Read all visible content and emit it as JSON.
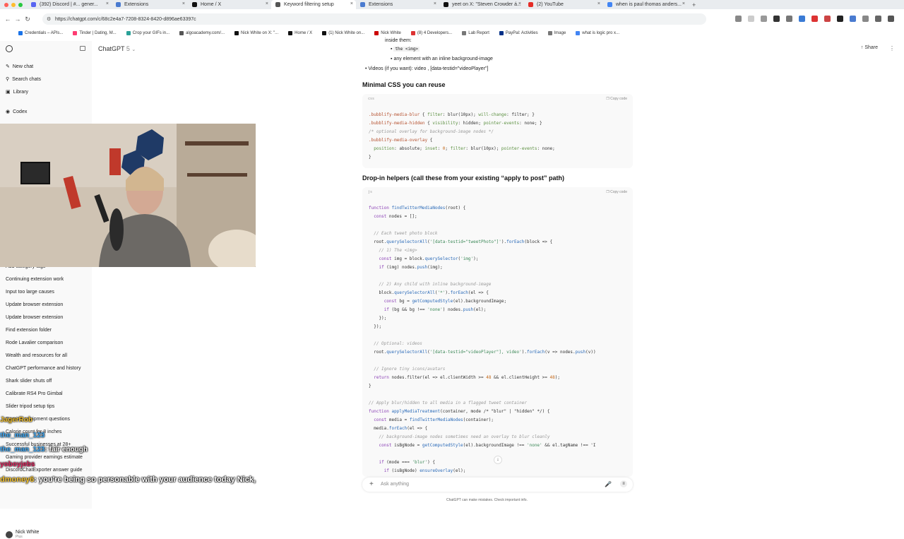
{
  "browser": {
    "tabs": [
      {
        "label": "(392) Discord | #... gener...",
        "color": "#5865f2"
      },
      {
        "label": "Extensions",
        "color": "#4a7bd0"
      },
      {
        "label": "Home / X",
        "color": "#111111"
      },
      {
        "label": "Keyword filtering setup",
        "color": "#555555",
        "active": true
      },
      {
        "label": "Extensions",
        "color": "#4a7bd0"
      },
      {
        "label": "yeet on X: \"Steven Crowder á...",
        "color": "#111111"
      },
      {
        "label": "(2) YouTube",
        "color": "#e52d27"
      },
      {
        "label": "when is paul thomas anders...",
        "color": "#4285f4"
      }
    ],
    "url": "https://chatgpt.com/c/68c2e4a7-7208-8324-8420-d896ae63397c",
    "bookmarks": [
      "Credentials – APIs...",
      "Tinder | Dating, M...",
      "Crop your GIFs in...",
      "algoacademy.com/...",
      "Nick White on X: \"...",
      "Home / X",
      "(1) Nick White on...",
      "Nick White",
      "(8) 4 Developers...",
      "Lab Report",
      "PayPal: Activities",
      "Image",
      "what is logic pro x..."
    ]
  },
  "sidebar": {
    "top_items": [
      "New chat",
      "Search chats",
      "Library",
      "Codex"
    ],
    "chats": [
      "Add category tags",
      "Continuing extension work",
      "Input too large causes",
      "Update browser extension",
      "Update browser extension",
      "Find extension folder",
      "Rode Lavalier comparison",
      "Wealth and resources for all",
      "ChatGPT performance and history",
      "Shark slider shuts off",
      "Calibrate RS4 Pro Gimbal",
      "Slider tripod setup tips",
      "Gaming equipment questions",
      "Calorie count for 8 inches",
      "Successful businesses at 28+",
      "Gaming provider earnings estimate",
      "DiscordChatExporter answer guide"
    ],
    "user_name": "Nick White",
    "user_plan": "Plus"
  },
  "header": {
    "title": "ChatGPT",
    "model": "5",
    "share": "Share"
  },
  "message": {
    "bullets": [
      "inside them:",
      "the <img>",
      "any element with an inline background-image",
      "Videos (if you want): video , [data-testid=\"videoPlayer\"]"
    ],
    "heading1": "Minimal CSS you can reuse",
    "heading2": "Drop-in helpers (call these from your existing “apply to post” path)",
    "css_lang": "css",
    "js_lang": "js",
    "copy_label": "Copy code"
  },
  "css_code": [
    ".bubblify-media-blur { filter: blur(10px); will-change: filter; }",
    ".bubblify-media-hidden { visibility: hidden; pointer-events: none; }",
    "/* optional overlay for background-image nodes */",
    ".bubblify-media-overlay {",
    "  position: absolute; inset: 0; filter: blur(10px); pointer-events: none;",
    "}"
  ],
  "js_code": [
    "function findTwitterMediaNodes(root) {",
    "  const nodes = [];",
    "",
    "  // Each tweet photo block",
    "  root.querySelectorAll('[data-testid=\"tweetPhoto\"]').forEach(block => {",
    "    // 1) The <img>",
    "    const img = block.querySelector('img');",
    "    if (img) nodes.push(img);",
    "",
    "    // 2) Any child with inline background-image",
    "    block.querySelectorAll('*').forEach(el => {",
    "      const bg = getComputedStyle(el).backgroundImage;",
    "      if (bg && bg !== 'none') nodes.push(el);",
    "    });",
    "  });",
    "",
    "  // Optional: videos",
    "  root.querySelectorAll('[data-testid=\"videoPlayer\"], video').forEach(v => nodes.push(v))",
    "",
    "  // Ignore tiny icons/avatars",
    "  return nodes.filter(el => el.clientWidth >= 48 && el.clientHeight >= 48);",
    "}",
    "",
    "// Apply blur/hidden to all media in a flagged tweet container",
    "function applyMediaTreatment(container, mode /* \"blur\" | \"hidden\" */) {",
    "  const media = findTwitterMediaNodes(container);",
    "  media.forEach(el => {",
    "    // background-image nodes sometimes need an overlay to blur cleanly",
    "    const isBgNode = getComputedStyle(el).backgroundImage !== 'none' && el.tagName !== 'I",
    "",
    "    if (mode === 'blur') {",
    "      if (isBgNode) ensureOverlay(el);"
  ],
  "composer": {
    "placeholder": "Ask anything"
  },
  "footer_note": "ChatGPT can make mistakes. Check important info.",
  "stream_chat": [
    {
      "user": "JagerRob",
      "text": "",
      "color": "#f2c12e"
    },
    {
      "user": "the_man_123",
      "text": "",
      "color": "#3fa9f5"
    },
    {
      "user": "the_man_123",
      "text": ": fair enough",
      "color": "#3fa9f5"
    },
    {
      "user": "yoboyjebs",
      "text": "",
      "color": "#e0245e"
    },
    {
      "user": "dmoney6",
      "text": ": you're being so personable with your audience today Nick,",
      "color": "#f2c12e"
    }
  ]
}
